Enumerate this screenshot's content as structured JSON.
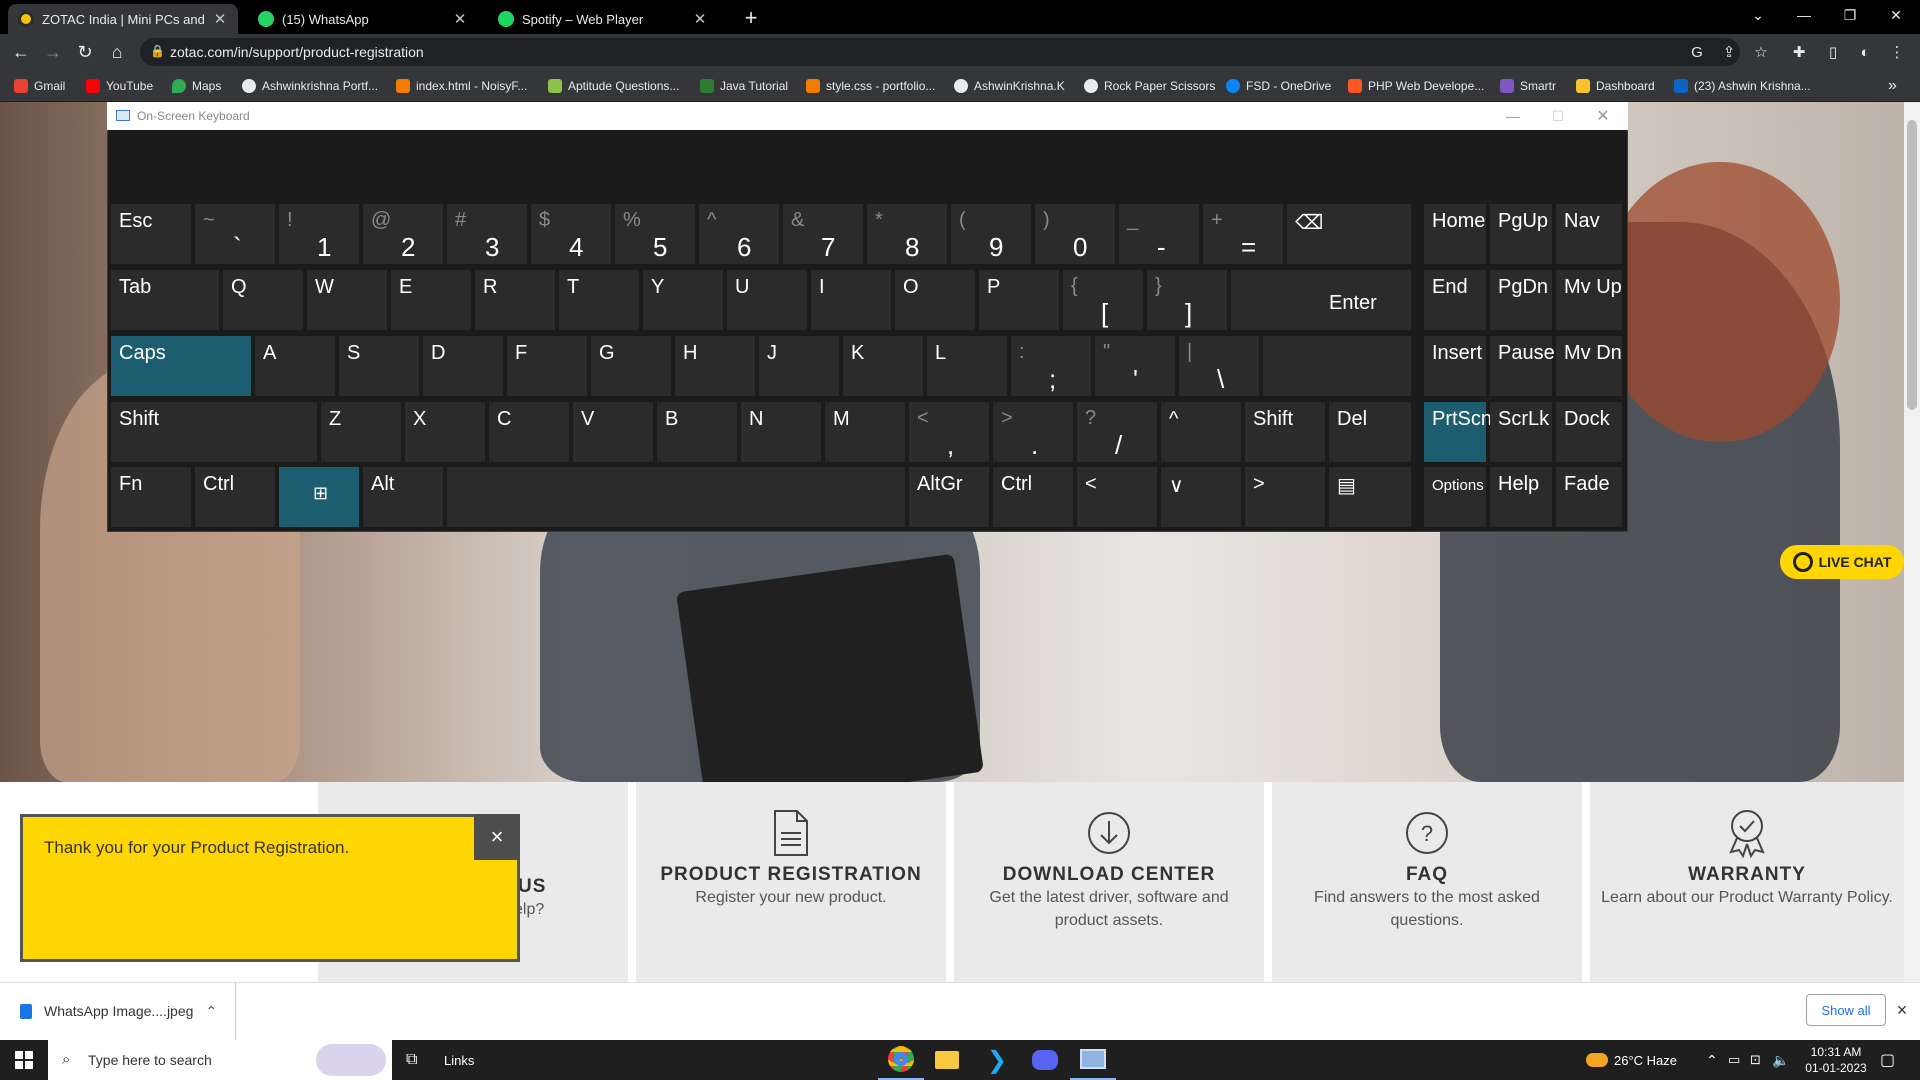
{
  "browser": {
    "tabs": [
      {
        "title": "ZOTAC India | Mini PCs and GeFo",
        "active": true,
        "icon": "zotac-icon"
      },
      {
        "title": "(15) WhatsApp",
        "active": false,
        "icon": "whatsapp-icon"
      },
      {
        "title": "Spotify – Web Player",
        "active": false,
        "icon": "spotify-icon"
      }
    ],
    "new_tab": "+",
    "url": "zotac.com/in/support/product-registration",
    "bookmarks": [
      "Gmail",
      "YouTube",
      "Maps",
      "Ashwinkrishna Portf...",
      "index.html - NoisyF...",
      "Aptitude Questions...",
      "Java Tutorial",
      "style.css - portfolio...",
      "AshwinKrishna.K",
      "Rock Paper Scissors",
      "FSD - OneDrive",
      "PHP Web Develope...",
      "Smartr",
      "Dashboard",
      "(23) Ashwin Krishna..."
    ],
    "bookmarks_more": "»"
  },
  "osk": {
    "title": "On-Screen Keyboard",
    "rows": [
      [
        {
          "main": "Esc"
        },
        {
          "shift": "~",
          "base": "`"
        },
        {
          "shift": "!",
          "base": "1"
        },
        {
          "shift": "@",
          "base": "2"
        },
        {
          "shift": "#",
          "base": "3"
        },
        {
          "shift": "$",
          "base": "4"
        },
        {
          "shift": "%",
          "base": "5"
        },
        {
          "shift": "^",
          "base": "6"
        },
        {
          "shift": "&",
          "base": "7"
        },
        {
          "shift": "*",
          "base": "8"
        },
        {
          "shift": "(",
          "base": "9"
        },
        {
          "shift": ")",
          "base": "0"
        },
        {
          "shift": "_",
          "base": "-"
        },
        {
          "shift": "+",
          "base": "="
        },
        {
          "main": "⌫"
        },
        {
          "main": "Home"
        },
        {
          "main": "PgUp"
        },
        {
          "main": "Nav"
        }
      ],
      [
        {
          "main": "Tab"
        },
        {
          "main": "Q"
        },
        {
          "main": "W"
        },
        {
          "main": "E"
        },
        {
          "main": "R"
        },
        {
          "main": "T"
        },
        {
          "main": "Y"
        },
        {
          "main": "U"
        },
        {
          "main": "I"
        },
        {
          "main": "O"
        },
        {
          "main": "P"
        },
        {
          "shift": "{",
          "base": "["
        },
        {
          "shift": "}",
          "base": "]"
        },
        {
          "main": "Enter"
        },
        {
          "main": "End"
        },
        {
          "main": "PgDn"
        },
        {
          "main": "Mv Up"
        }
      ],
      [
        {
          "main": "Caps",
          "active": true
        },
        {
          "main": "A"
        },
        {
          "main": "S"
        },
        {
          "main": "D"
        },
        {
          "main": "F"
        },
        {
          "main": "G"
        },
        {
          "main": "H"
        },
        {
          "main": "J"
        },
        {
          "main": "K"
        },
        {
          "main": "L"
        },
        {
          "shift": ":",
          "base": ";"
        },
        {
          "shift": "\"",
          "base": "'"
        },
        {
          "shift": "|",
          "base": "\\"
        },
        {
          "main": ""
        },
        {
          "main": "Insert"
        },
        {
          "main": "Pause"
        },
        {
          "main": "Mv Dn"
        }
      ],
      [
        {
          "main": "Shift"
        },
        {
          "main": "Z"
        },
        {
          "main": "X"
        },
        {
          "main": "C"
        },
        {
          "main": "V"
        },
        {
          "main": "B"
        },
        {
          "main": "N"
        },
        {
          "main": "M"
        },
        {
          "shift": "<",
          "base": ","
        },
        {
          "shift": ">",
          "base": "."
        },
        {
          "shift": "?",
          "base": "/"
        },
        {
          "main": "^"
        },
        {
          "main": "Shift"
        },
        {
          "main": "Del"
        },
        {
          "main": "PrtScn",
          "active": true
        },
        {
          "main": "ScrLk"
        },
        {
          "main": "Dock"
        }
      ],
      [
        {
          "main": "Fn"
        },
        {
          "main": "Ctrl"
        },
        {
          "main": "⊞",
          "active": true
        },
        {
          "main": "Alt"
        },
        {
          "main": ""
        },
        {
          "main": "AltGr"
        },
        {
          "main": "Ctrl"
        },
        {
          "main": "<"
        },
        {
          "main": "∨"
        },
        {
          "main": ">"
        },
        {
          "main": "▤"
        },
        {
          "main": "Options"
        },
        {
          "main": "Help"
        },
        {
          "main": "Fade"
        }
      ]
    ]
  },
  "page": {
    "live_chat": "LIVE CHAT",
    "notification": {
      "text": "Thank you for your Product Registration.",
      "close": "×"
    },
    "cards": [
      {
        "title": "US",
        "desc": "elp?"
      },
      {
        "title": "PRODUCT REGISTRATION",
        "desc": "Register your new product."
      },
      {
        "title": "DOWNLOAD CENTER",
        "desc": "Get the latest driver, software and product assets."
      },
      {
        "title": "FAQ",
        "desc": "Find answers to the most asked questions."
      },
      {
        "title": "WARRANTY",
        "desc": "Learn about our Product Warranty Policy."
      }
    ]
  },
  "downloads": {
    "file": "WhatsApp Image....jpeg",
    "show_all": "Show all",
    "close": "×"
  },
  "taskbar": {
    "search_placeholder": "Type here to search",
    "links": "Links",
    "weather": "26°C  Haze",
    "time": "10:31 AM",
    "date": "01-01-2023"
  },
  "colors": {
    "zotac_yellow": "#ffd600",
    "osk_active": "#1c5e70",
    "chrome_dark": "#35363a"
  }
}
